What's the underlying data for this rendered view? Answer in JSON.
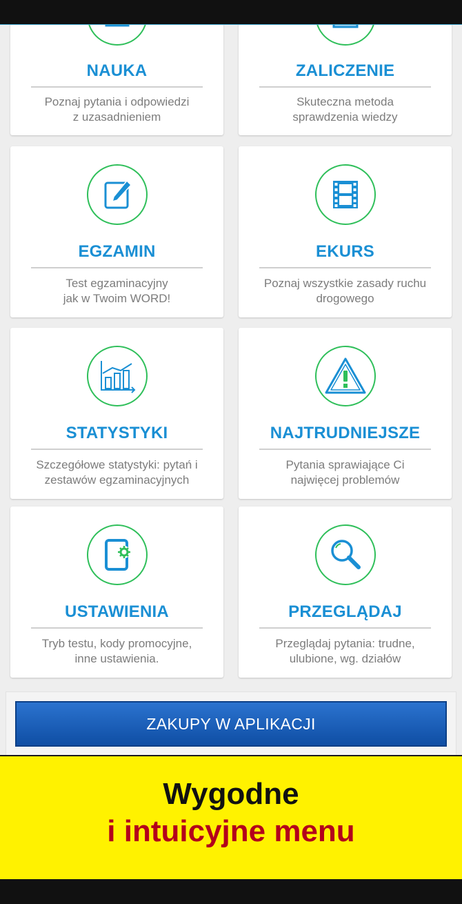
{
  "menu": {
    "items": [
      {
        "title": "NAUKA",
        "desc1": "Poznaj pytania i odpowiedzi",
        "desc2": "z uzasadnieniem",
        "icon": "book-icon"
      },
      {
        "title": "ZALICZENIE",
        "desc1": "Skuteczna metoda",
        "desc2": "sprawdzenia wiedzy",
        "icon": "checklist-icon"
      },
      {
        "title": "EGZAMIN",
        "desc1": "Test egzaminacyjny",
        "desc2": "jak w Twoim WORD!",
        "icon": "pencil-document-icon"
      },
      {
        "title": "EKURS",
        "desc1": "Poznaj wszystkie zasady ruchu",
        "desc2": "drogowego",
        "icon": "film-strip-icon"
      },
      {
        "title": "STATYSTYKI",
        "desc1": "Szczegółowe statystyki: pytań i",
        "desc2": "zestawów egzaminacyjnych",
        "icon": "bar-chart-icon"
      },
      {
        "title": "NAJTRUDNIEJSZE",
        "desc1": "Pytania sprawiające Ci",
        "desc2": "najwięcej problemów",
        "icon": "warning-icon"
      },
      {
        "title": "USTAWIENIA",
        "desc1": "Tryb testu, kody promocyjne,",
        "desc2": "inne ustawienia.",
        "icon": "tablet-settings-icon"
      },
      {
        "title": "PRZEGLĄDAJ",
        "desc1": "Przeglądaj pytania: trudne,",
        "desc2": "ulubione, wg. działów",
        "icon": "magnifier-icon"
      }
    ]
  },
  "purchase": {
    "label": "ZAKUPY W APLIKACJI"
  },
  "promo": {
    "line1": "Wygodne",
    "line2": "i intuicyjne menu"
  },
  "colors": {
    "accent_blue": "#1a8fd4",
    "icon_green": "#2fbf5a",
    "promo_yellow": "#fff200",
    "promo_red": "#b3001b"
  }
}
